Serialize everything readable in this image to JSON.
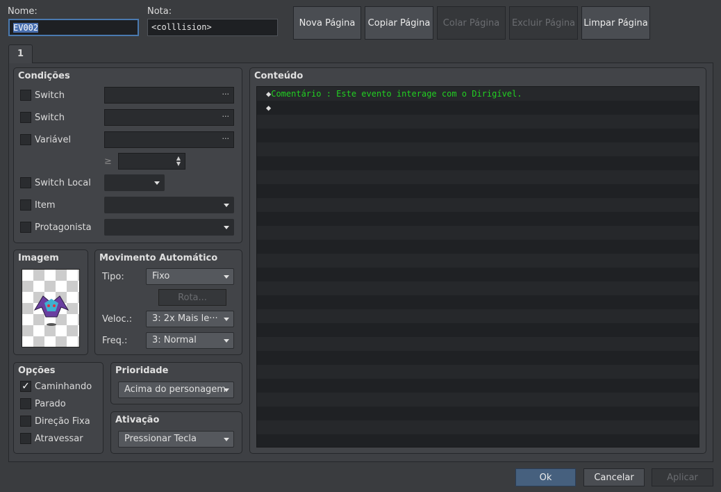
{
  "header": {
    "name_label": "Nome:",
    "name_value": "EV002",
    "note_label": "Nota:",
    "note_value": "<colllision>"
  },
  "toolbar": {
    "new_page": "Nova Página",
    "copy_page": "Copiar Página",
    "paste_page": "Colar Página",
    "delete_page": "Excluir Página",
    "clear_page": "Limpar Página"
  },
  "tabs": [
    {
      "label": "1"
    }
  ],
  "conditions": {
    "title": "Condições",
    "switch1": "Switch",
    "switch2": "Switch",
    "variable": "Variável",
    "ellipsis": "···",
    "gte": "≥",
    "self_switch": "Switch Local",
    "item": "Item",
    "actor": "Protagonista"
  },
  "image": {
    "title": "Imagem"
  },
  "movement": {
    "title": "Movimento Automático",
    "type_label": "Tipo:",
    "type_value": "Fixo",
    "route": "Rota...",
    "speed_label": "Veloc.:",
    "speed_value": "3: 2x Mais le···",
    "freq_label": "Freq.:",
    "freq_value": "3: Normal"
  },
  "options": {
    "title": "Opções",
    "walking": "Caminhando",
    "stepping": "Parado",
    "direction_fix": "Direção Fixa",
    "through": "Atravessar",
    "checked": {
      "walking": true,
      "stepping": false,
      "direction_fix": false,
      "through": false
    }
  },
  "priority": {
    "title": "Prioridade",
    "value": "Acima do personagem"
  },
  "trigger": {
    "title": "Ativação",
    "value": "Pressionar Tecla"
  },
  "contents": {
    "title": "Conteúdo",
    "lines": [
      {
        "marker": "◆",
        "text": "Comentário : Este evento interage com o Dirigível."
      },
      {
        "marker": "◆",
        "text": ""
      }
    ]
  },
  "footer": {
    "ok": "Ok",
    "cancel": "Cancelar",
    "apply": "Aplicar"
  }
}
